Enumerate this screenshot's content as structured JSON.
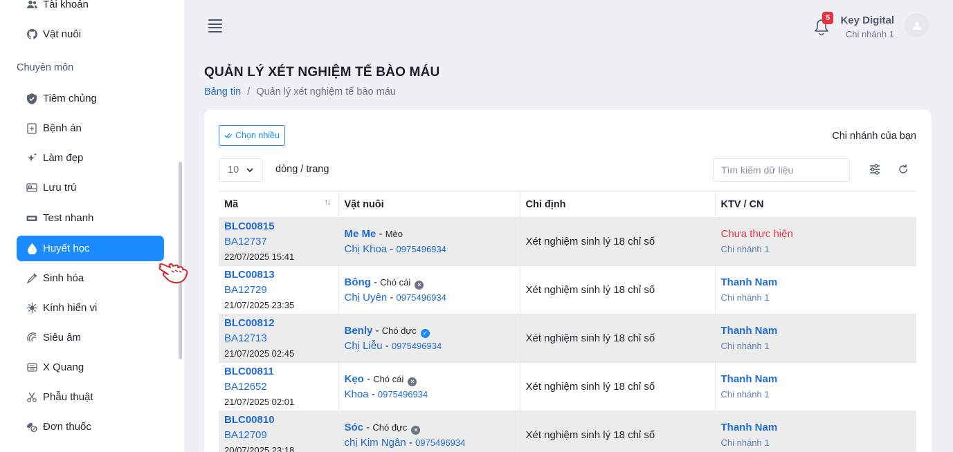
{
  "sidebar": {
    "top_items": [
      {
        "label": "Tài khoản",
        "icon": "users-icon"
      },
      {
        "label": "Vật nuôi",
        "icon": "github-icon"
      }
    ],
    "section_label": "Chuyên môn",
    "items": [
      {
        "label": "Tiêm chủng",
        "icon": "shield-icon"
      },
      {
        "label": "Bệnh án",
        "icon": "medical-file-icon"
      },
      {
        "label": "Làm đẹp",
        "icon": "sparkle-icon"
      },
      {
        "label": "Lưu trú",
        "icon": "bed-icon"
      },
      {
        "label": "Test nhanh",
        "icon": "test-kit-icon"
      },
      {
        "label": "Huyết học",
        "icon": "blood-drop-icon",
        "active": true
      },
      {
        "label": "Sinh hóa",
        "icon": "pipette-icon"
      },
      {
        "label": "Kính hiển vi",
        "icon": "virus-icon"
      },
      {
        "label": "Siêu âm",
        "icon": "ultrasound-icon"
      },
      {
        "label": "X Quang",
        "icon": "xray-icon"
      },
      {
        "label": "Phẫu thuật",
        "icon": "scissors-icon"
      },
      {
        "label": "Đơn thuốc",
        "icon": "pills-icon"
      }
    ]
  },
  "header": {
    "notification_count": "5",
    "user_name": "Key Digital",
    "user_branch": "Chi nhánh 1"
  },
  "page": {
    "title": "QUẢN LÝ XÉT NGHIỆM TẾ BÀO MÁU",
    "breadcrumb_home": "Bảng tin",
    "breadcrumb_sep": "/",
    "breadcrumb_current": "Quản lý xét nghiệm tế bào máu"
  },
  "toolbar": {
    "multi_select_label": "Chọn nhiều",
    "branch_label": "Chi nhánh của bạn",
    "page_size": "10",
    "rows_per_page_label": "dòng / trang",
    "search_placeholder": "Tìm kiếm dữ liệu"
  },
  "table": {
    "headers": [
      "Mã",
      "Vật nuôi",
      "Chỉ định",
      "KTV / CN"
    ],
    "rows": [
      {
        "code": "BLC00815",
        "ref": "BA12737",
        "date": "22/07/2025 15:41",
        "pet": "Me Me",
        "species": "Mèo",
        "status_icon": "",
        "owner": "Chị Khoa",
        "phone": "0975496934",
        "test": "Xét nghiệm sinh lý 18 chỉ số",
        "ktv": "Chưa thực hiện",
        "ktv_pending": true,
        "branch": "Chi nhánh 1"
      },
      {
        "code": "BLC00813",
        "ref": "BA12729",
        "date": "21/07/2025 23:35",
        "pet": "Bông",
        "species": "Chó cái",
        "status_icon": "x",
        "owner": "Chị Uyên",
        "phone": "0975496934",
        "test": "Xét nghiệm sinh lý 18 chỉ số",
        "ktv": "Thanh Nam",
        "ktv_pending": false,
        "branch": "Chi nhánh 1"
      },
      {
        "code": "BLC00812",
        "ref": "BA12713",
        "date": "21/07/2025 02:45",
        "pet": "Benly",
        "species": "Chó đực",
        "status_icon": "ok",
        "owner": "Chị Liễu",
        "phone": "0975496934",
        "test": "Xét nghiệm sinh lý 18 chỉ số",
        "ktv": "Thanh Nam",
        "ktv_pending": false,
        "branch": "Chi nhánh 1"
      },
      {
        "code": "BLC00811",
        "ref": "BA12652",
        "date": "21/07/2025 02:01",
        "pet": "Kẹo",
        "species": "Chó cái",
        "status_icon": "x",
        "owner": "Khoa",
        "phone": "0975496934",
        "test": "Xét nghiệm sinh lý 18 chỉ số",
        "ktv": "Thanh Nam",
        "ktv_pending": false,
        "branch": "Chi nhánh 1"
      },
      {
        "code": "BLC00810",
        "ref": "BA12709",
        "date": "20/07/2025 23:18",
        "pet": "Sóc",
        "species": "Chó đực",
        "status_icon": "x",
        "owner": "chị Kim Ngân",
        "phone": "0975496934",
        "test": "Xét nghiệm sinh lý 18 chỉ số",
        "ktv": "Thanh Nam",
        "ktv_pending": false,
        "branch": "Chi nhánh 1"
      }
    ]
  },
  "colors": {
    "primary": "#1a8cff",
    "link": "#1e6bd6",
    "pending": "#e03a4a",
    "badge": "#e5333f"
  }
}
